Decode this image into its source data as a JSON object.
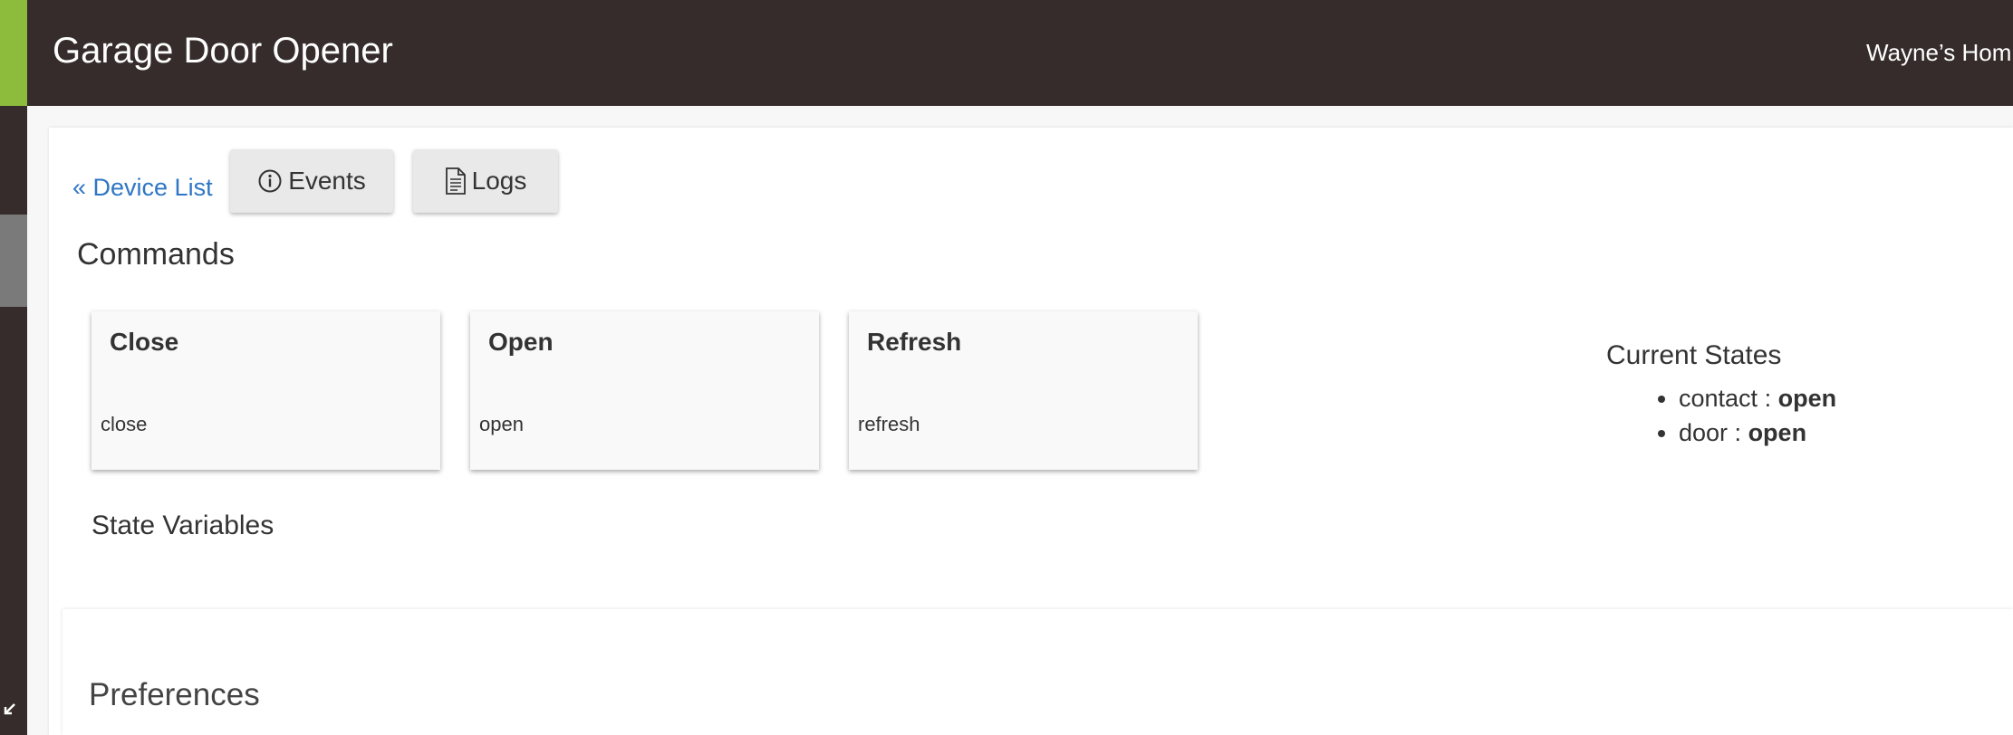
{
  "header": {
    "title": "Garage Door Opener",
    "hub_name": "Wayne’s Hom"
  },
  "toolbar": {
    "back_link": "« Device List",
    "events_label": "Events",
    "logs_label": "Logs"
  },
  "commands": {
    "title": "Commands",
    "cards": [
      {
        "name": "Close",
        "method": "close"
      },
      {
        "name": "Open",
        "method": "open"
      },
      {
        "name": "Refresh",
        "method": "refresh"
      }
    ]
  },
  "state_variables": {
    "title": "State Variables"
  },
  "current_states": {
    "title": "Current States",
    "items": [
      {
        "key": "contact",
        "sep": " : ",
        "value": "open"
      },
      {
        "key": "door",
        "sep": " : ",
        "value": "open"
      }
    ]
  },
  "preferences": {
    "title": "Preferences"
  },
  "colors": {
    "header_bg": "#352c2b",
    "accent": "#8dbb3c",
    "link": "#2f76c4"
  },
  "icons": {
    "events": "info-circle-icon",
    "logs": "document-icon",
    "rail": "collapse-arrow-icon"
  }
}
